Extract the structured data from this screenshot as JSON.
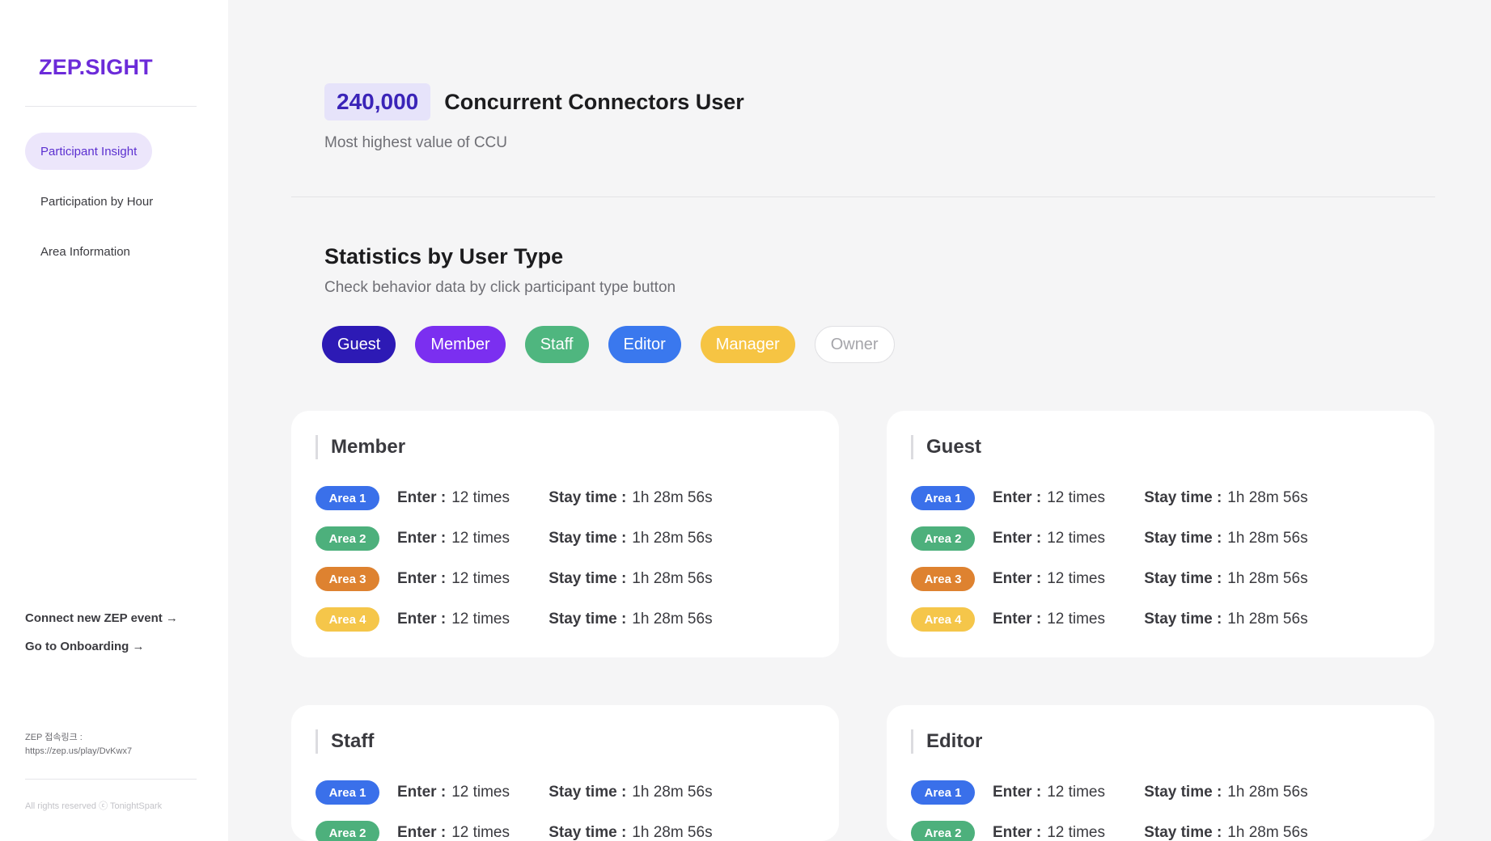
{
  "sidebar": {
    "logo": "ZEP.SIGHT",
    "nav": [
      {
        "label": "Participant Insight",
        "active": true
      },
      {
        "label": "Participation by Hour",
        "active": false
      },
      {
        "label": "Area Information",
        "active": false
      }
    ],
    "links": {
      "connect": "Connect new ZEP event →",
      "onboarding": "Go to Onboarding →"
    },
    "zep_link_label": "ZEP 접속링크 :",
    "zep_link_url": "https://zep.us/play/DvKwx7",
    "copyright": "All rights reserved ⓒ TonightSpark"
  },
  "ccu": {
    "value": "240,000",
    "label": "Concurrent Connectors User",
    "subtitle": "Most highest value of CCU"
  },
  "stats": {
    "title": "Statistics by User Type",
    "subtitle": "Check behavior data by click participant type button",
    "type_buttons": [
      {
        "label": "Guest",
        "color": "#2d1ab5"
      },
      {
        "label": "Member",
        "color": "#7b2ff0"
      },
      {
        "label": "Staff",
        "color": "#4fb67f"
      },
      {
        "label": "Editor",
        "color": "#3a78ee"
      },
      {
        "label": "Manager",
        "color": "#f6c443"
      },
      {
        "label": "Owner",
        "color": "#ffffff"
      }
    ],
    "area_colors": [
      "#3a70ea",
      "#4db07c",
      "#de8230",
      "#f5c64a"
    ],
    "enter_label": "Enter :",
    "stay_label": "Stay time :",
    "cards": [
      {
        "title": "Member",
        "rows": [
          {
            "area": "Area 1",
            "enter": "12 times",
            "stay": "1h 28m 56s"
          },
          {
            "area": "Area 2",
            "enter": "12 times",
            "stay": "1h 28m 56s"
          },
          {
            "area": "Area 3",
            "enter": "12 times",
            "stay": "1h 28m 56s"
          },
          {
            "area": "Area 4",
            "enter": "12 times",
            "stay": "1h 28m 56s"
          }
        ]
      },
      {
        "title": "Guest",
        "rows": [
          {
            "area": "Area 1",
            "enter": "12 times",
            "stay": "1h 28m 56s"
          },
          {
            "area": "Area 2",
            "enter": "12 times",
            "stay": "1h 28m 56s"
          },
          {
            "area": "Area 3",
            "enter": "12 times",
            "stay": "1h 28m 56s"
          },
          {
            "area": "Area 4",
            "enter": "12 times",
            "stay": "1h 28m 56s"
          }
        ]
      },
      {
        "title": "Staff",
        "rows": [
          {
            "area": "Area 1",
            "enter": "12 times",
            "stay": "1h 28m 56s"
          },
          {
            "area": "Area 2",
            "enter": "12 times",
            "stay": "1h 28m 56s"
          }
        ]
      },
      {
        "title": "Editor",
        "rows": [
          {
            "area": "Area 1",
            "enter": "12 times",
            "stay": "1h 28m 56s"
          },
          {
            "area": "Area 2",
            "enter": "12 times",
            "stay": "1h 28m 56s"
          }
        ]
      }
    ]
  }
}
